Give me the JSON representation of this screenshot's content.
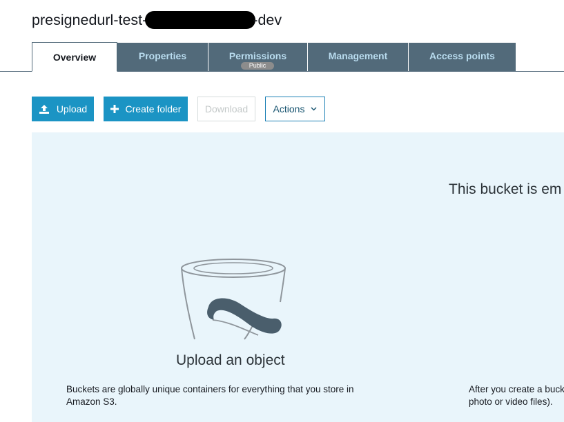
{
  "bucket": {
    "name_prefix": "presignedurl-test-",
    "name_suffix": "-dev"
  },
  "tabs": [
    {
      "label": "Overview",
      "active": true
    },
    {
      "label": "Properties"
    },
    {
      "label": "Permissions",
      "badge": "Public"
    },
    {
      "label": "Management"
    },
    {
      "label": "Access points"
    }
  ],
  "toolbar": {
    "upload_label": "Upload",
    "create_folder_label": "Create folder",
    "download_label": "Download",
    "actions_label": "Actions"
  },
  "empty_state": {
    "title": "This bucket is em",
    "upload_title": "Upload an object",
    "upload_description": "Buckets are globally unique containers for everything that you store in Amazon S3.",
    "after_description_line1": "After you create a buck",
    "after_description_line2": "photo or video files)."
  },
  "icons": {
    "upload": "upload-icon",
    "create_folder": "plus-icon",
    "actions": "chevron-down-icon",
    "illustration": "bucket-illustration-icon"
  },
  "colors": {
    "primary_button": "#1b94c4",
    "tab_inactive_bg": "#526a7a",
    "tab_inactive_text": "#b9dcef",
    "panel_bg": "#e9f5fb"
  }
}
